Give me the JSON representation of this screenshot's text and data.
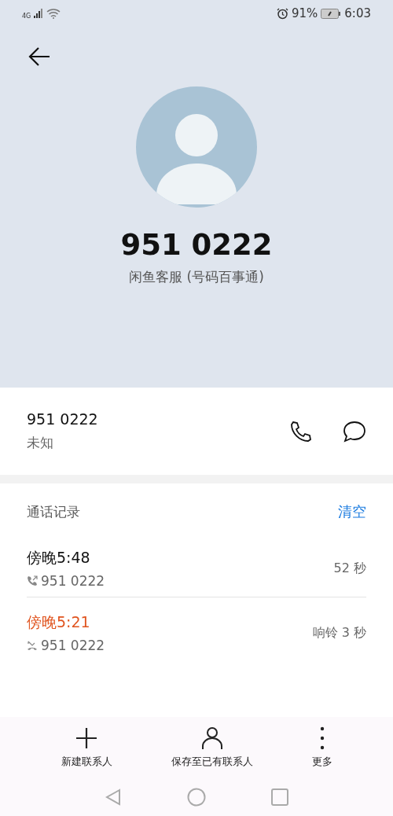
{
  "status_bar": {
    "network": "4G",
    "battery": "91%",
    "time": "6:03"
  },
  "contact": {
    "number": "951 0222",
    "label": "闲鱼客服 (号码百事通)"
  },
  "number_card": {
    "number": "951 0222",
    "type": "未知"
  },
  "call_log": {
    "title": "通话记录",
    "clear": "清空",
    "calls": [
      {
        "kind": "outgoing",
        "time": "傍晚5:48",
        "number": "951 0222",
        "duration": "52 秒"
      },
      {
        "kind": "missed",
        "time": "傍晚5:21",
        "number": "951 0222",
        "duration": "响铃 3 秒"
      }
    ]
  },
  "actions": [
    {
      "kind": "add",
      "label": "新建联系人"
    },
    {
      "kind": "person",
      "label": "保存至已有联系人"
    },
    {
      "kind": "more",
      "label": "更多"
    }
  ]
}
